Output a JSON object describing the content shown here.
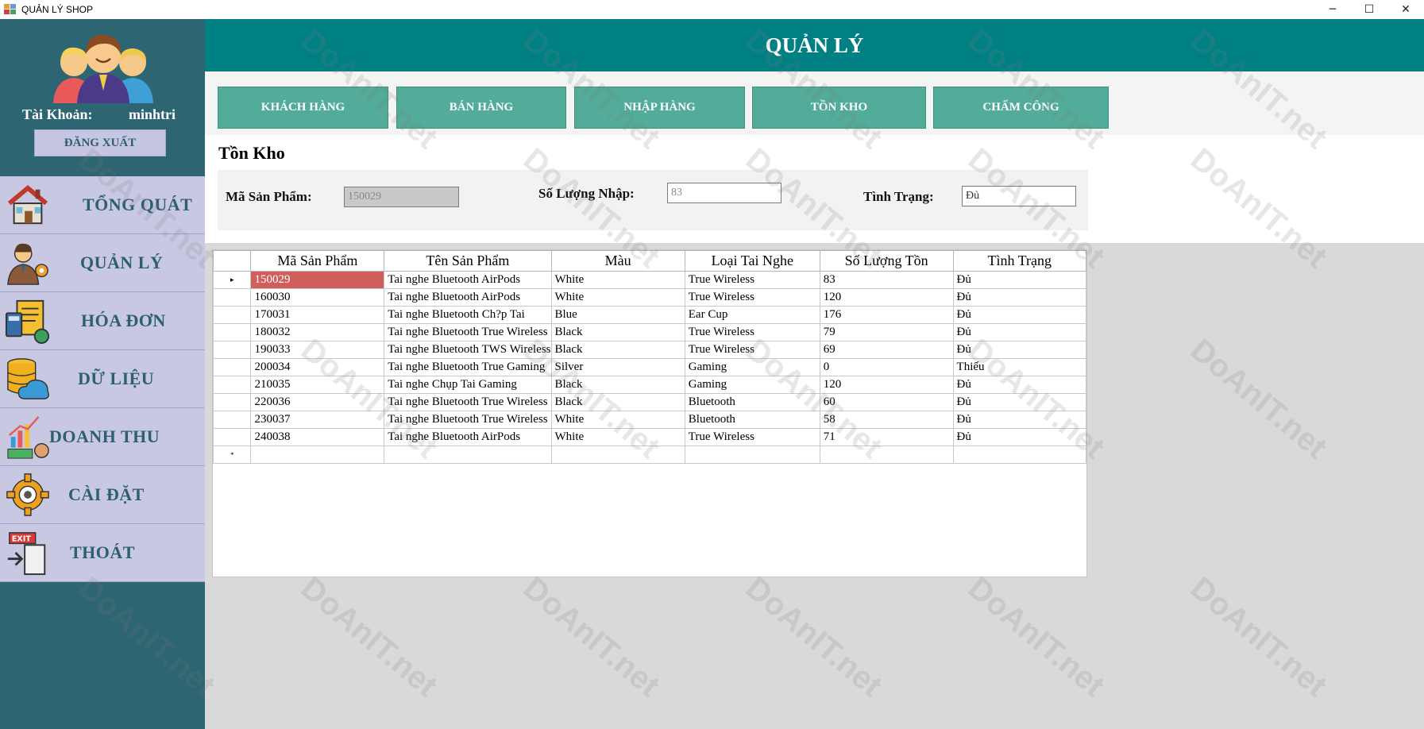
{
  "window": {
    "title": "QUẢN LÝ SHOP",
    "minimize": "─",
    "maximize": "☐",
    "close": "✕"
  },
  "sidebar": {
    "account_label": "Tài Khoản:",
    "account_value": "minhtri",
    "logout_label": "ĐĂNG XUẤT",
    "items": [
      {
        "label": "TỔNG QUÁT",
        "icon": "house-icon"
      },
      {
        "label": "QUẢN LÝ",
        "icon": "manager-icon"
      },
      {
        "label": "HÓA ĐƠN",
        "icon": "invoice-icon"
      },
      {
        "label": "DỮ LIỆU",
        "icon": "database-icon"
      },
      {
        "label": "DOANH THU",
        "icon": "revenue-icon"
      },
      {
        "label": "CÀI ĐẶT",
        "icon": "gear-icon"
      },
      {
        "label": "THOÁT",
        "icon": "exit-icon"
      }
    ]
  },
  "header": {
    "title": "QUẢN LÝ"
  },
  "tabs": [
    {
      "label": "KHÁCH HÀNG"
    },
    {
      "label": "BÁN HÀNG"
    },
    {
      "label": "NHẬP HÀNG"
    },
    {
      "label": "TỒN KHO"
    },
    {
      "label": "CHẤM CÔNG"
    }
  ],
  "section": {
    "title": "Tồn Kho"
  },
  "form": {
    "product_code_label": "Mã Sản Phẩm:",
    "product_code_value": "150029",
    "quantity_label": "Số Lượng Nhập:",
    "quantity_value": "83",
    "status_label": "Tình Trạng:",
    "status_value": "Đủ"
  },
  "grid": {
    "columns": [
      "Mã Sản Phẩm",
      "Tên Sản Phẩm",
      "Màu",
      "Loại Tai Nghe",
      "Số Lượng Tồn",
      "Tình Trạng"
    ],
    "rows": [
      [
        "150029",
        "Tai nghe Bluetooth AirPods",
        "White",
        "True Wireless",
        "83",
        "Đủ"
      ],
      [
        "160030",
        "Tai nghe Bluetooth AirPods",
        "White",
        "True Wireless",
        "120",
        "Đủ"
      ],
      [
        "170031",
        "Tai nghe Bluetooth Ch?p Tai",
        "Blue",
        "Ear Cup",
        "176",
        "Đủ"
      ],
      [
        "180032",
        "Tai nghe Bluetooth True Wireless",
        "Black",
        "True Wireless",
        "79",
        "Đủ"
      ],
      [
        "190033",
        "Tai nghe Bluetooth TWS Wireless",
        "Black",
        "True Wireless",
        "69",
        "Đủ"
      ],
      [
        "200034",
        "Tai nghe Bluetooth True Gaming",
        "Silver",
        "Gaming",
        "0",
        "Thiếu"
      ],
      [
        "210035",
        "Tai nghe Chụp Tai Gaming",
        "Black",
        "Gaming",
        "120",
        "Đủ"
      ],
      [
        "220036",
        "Tai nghe Bluetooth True Wireless",
        "Black",
        "Bluetooth",
        "60",
        "Đủ"
      ],
      [
        "230037",
        "Tai nghe Bluetooth True Wireless",
        "White",
        "Bluetooth",
        "58",
        "Đủ"
      ],
      [
        "240038",
        "Tai nghe Bluetooth AirPods",
        "White",
        "True Wireless",
        "71",
        "Đủ"
      ]
    ],
    "selected_row": 0,
    "current_marker": "▸",
    "new_row_marker": "*"
  },
  "colors": {
    "sidebar": "#2e6572",
    "menu": "#c9c8e3",
    "header": "#008083",
    "tab": "#52ac99",
    "selected_cell": "#d05e5c"
  },
  "watermark": "DoAnIT.net"
}
